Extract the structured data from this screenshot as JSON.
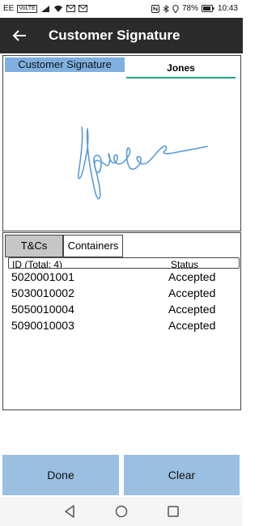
{
  "status_bar": {
    "carrier": "EE",
    "volte": "VoLTE",
    "battery": "78%",
    "time": "10:43"
  },
  "header": {
    "title": "Customer Signature"
  },
  "signature": {
    "label": "Customer Signature",
    "name": "Jones"
  },
  "tabs": [
    {
      "label": "T&Cs"
    },
    {
      "label": "Containers"
    }
  ],
  "table": {
    "col_id": "ID (Total: 4)",
    "col_status": "Status",
    "rows": [
      {
        "id": "5020001001",
        "status": "Accepted"
      },
      {
        "id": "5030010002",
        "status": "Accepted"
      },
      {
        "id": "5050010004",
        "status": "Accepted"
      },
      {
        "id": "5090010003",
        "status": "Accepted"
      }
    ]
  },
  "buttons": {
    "done": "Done",
    "clear": "Clear"
  },
  "colors": {
    "appbar": "#2b2b2b",
    "accent_blue": "#9bbfe1",
    "label_blue": "#7fb0e0",
    "underline_teal": "#1aa58a"
  }
}
